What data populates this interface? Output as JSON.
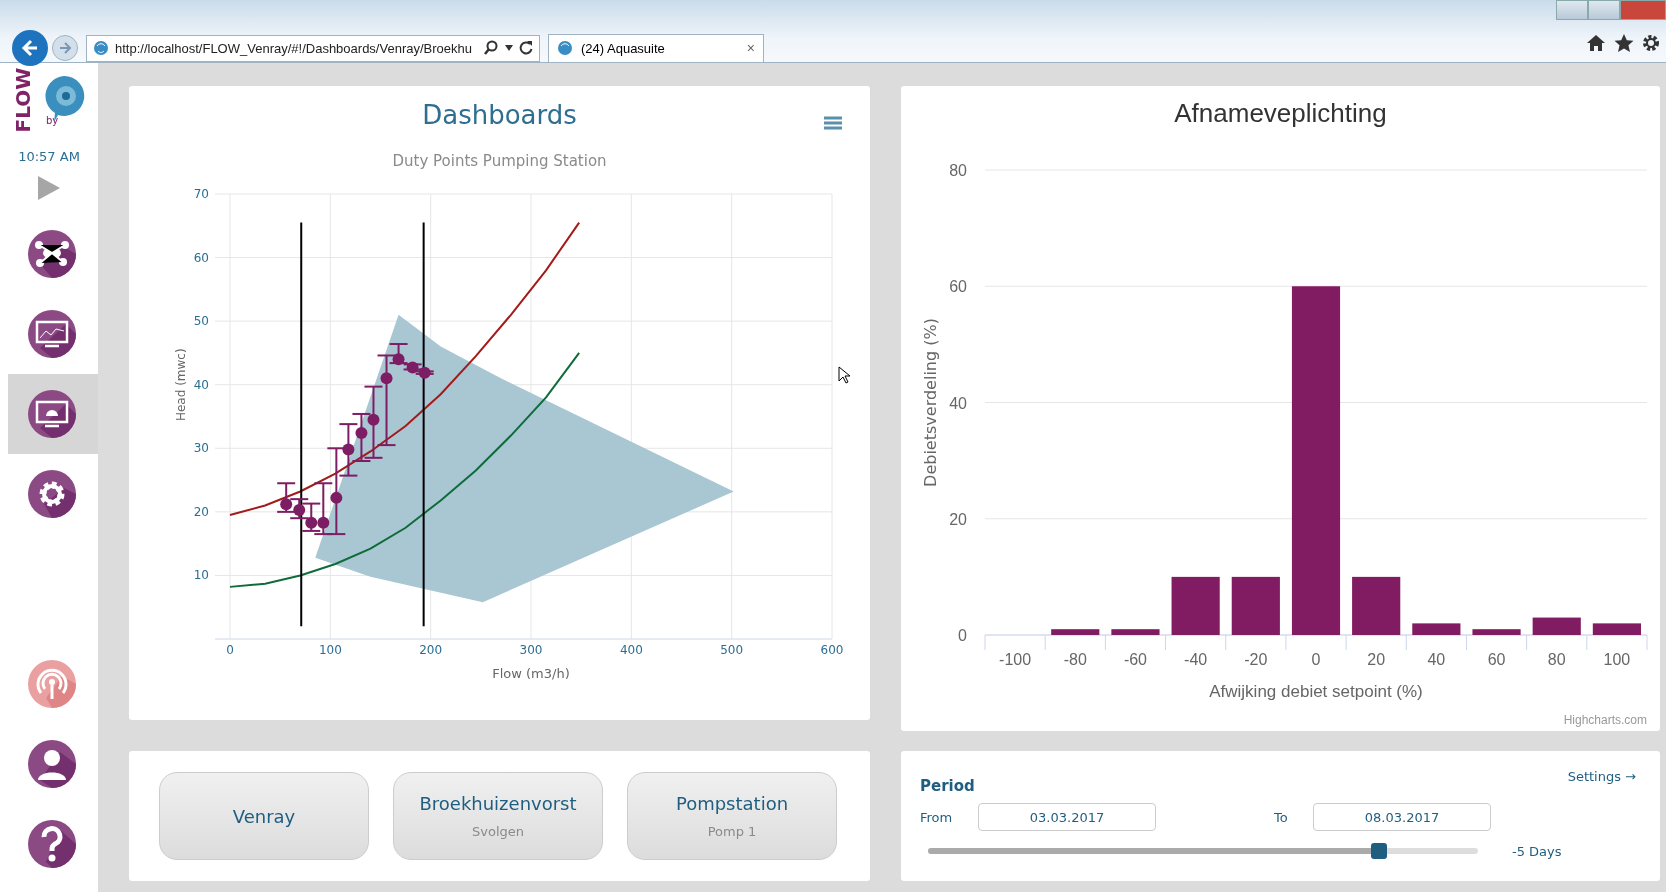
{
  "browser": {
    "url": "http://localhost/FLOW_Venray/#!/Dashboards/Venray/Broekhu",
    "tab": {
      "label": "(24) Aquasuite",
      "close": "×"
    }
  },
  "sidebar": {
    "logo": {
      "wordmark": "FLOW",
      "by": "by"
    },
    "time": "10:57 AM",
    "items": [
      {
        "selected": false
      },
      {
        "selected": false
      },
      {
        "selected": true
      },
      {
        "selected": false
      },
      {
        "selected": false
      },
      {
        "selected": false
      },
      {
        "selected": false
      }
    ]
  },
  "duty_panel": {
    "title": "Dashboards",
    "subtitle": "Duty Points Pumping Station",
    "chart_data": {
      "type": "line",
      "grid": true,
      "xlabel": "Flow (m3/h)",
      "ylabel": "Head (mwc)",
      "xlim": [
        0,
        600
      ],
      "ylim": [
        0,
        70
      ],
      "xticks": [
        0,
        100,
        200,
        300,
        400,
        500,
        600
      ],
      "yticks": [
        10,
        20,
        30,
        40,
        50,
        60,
        70
      ],
      "series": [
        {
          "type": "area",
          "color": "#a9c6d3",
          "x": [
            85,
            168,
            210,
            270,
            502,
            252,
            140
          ],
          "values": [
            12.8,
            51,
            46,
            41,
            23.2,
            5.8,
            9.8
          ]
        },
        {
          "type": "line",
          "color": "#a31a1a",
          "x": [
            0,
            35,
            70,
            105,
            140,
            175,
            210,
            245,
            280,
            315,
            348
          ],
          "values": [
            19.5,
            21,
            23.2,
            26,
            29.5,
            33.5,
            38.5,
            44.5,
            51,
            58,
            65.5
          ]
        },
        {
          "type": "line",
          "color": "#0f6b3a",
          "x": [
            0,
            35,
            70,
            105,
            140,
            175,
            210,
            245,
            280,
            315,
            348
          ],
          "values": [
            8.2,
            8.7,
            10,
            11.8,
            14.2,
            17.5,
            21.8,
            26.5,
            32,
            38,
            45
          ]
        },
        {
          "type": "line",
          "color": "#000000",
          "x": [
            71,
            71
          ],
          "values": [
            2,
            65.5
          ]
        },
        {
          "type": "line",
          "color": "#000000",
          "x": [
            193,
            193
          ],
          "values": [
            2,
            65.5
          ]
        },
        {
          "type": "scatter",
          "color": "#7d1d63",
          "x": [
            56,
            69,
            81,
            93,
            106,
            118,
            131,
            143,
            156,
            168,
            182,
            194
          ],
          "values": [
            21.2,
            20.3,
            18.3,
            18.3,
            22.2,
            29.8,
            32.4,
            34.5,
            41,
            44,
            42.7,
            41.9
          ],
          "errors": [
            [
              20,
              24.5
            ],
            [
              19,
              22
            ],
            [
              17,
              21.3
            ],
            [
              16.5,
              24.5
            ],
            [
              16.5,
              30
            ],
            [
              25.7,
              33.8
            ],
            [
              28,
              35.4
            ],
            [
              28.5,
              39.7
            ],
            [
              30.5,
              44.6
            ],
            [
              43.4,
              46.4
            ],
            [
              42.4,
              43.2
            ],
            [
              41.7,
              42.1
            ]
          ]
        }
      ]
    }
  },
  "distribution_panel": {
    "title": "Afnameveplichting",
    "credit": "Highcharts.com",
    "chart_data": {
      "type": "bar",
      "grid": true,
      "xlabel": "Afwijking debiet setpoint (%)",
      "ylabel": "Debietsverdeling (%)",
      "categories": [
        "-100",
        "-80",
        "-60",
        "-40",
        "-20",
        "0",
        "20",
        "40",
        "60",
        "80",
        "100"
      ],
      "ylim": [
        0,
        80
      ],
      "yticks": [
        0,
        20,
        40,
        60,
        80
      ],
      "series": [
        {
          "color": "#821c62",
          "values": [
            0,
            1,
            1,
            10,
            10,
            60,
            10,
            2,
            1,
            3,
            2
          ]
        }
      ]
    }
  },
  "navigation": [
    {
      "title": "Venray"
    },
    {
      "title": "Broekhuizenvorst",
      "subtitle": "Svolgen"
    },
    {
      "title": "Pompstation",
      "subtitle": "Pomp 1"
    }
  ],
  "period": {
    "title": "Period",
    "settings_link": "Settings →",
    "from_label": "From",
    "from_value": "03.03.2017",
    "to_label": "To",
    "to_value": "08.03.2017",
    "slider": {
      "level": 0.82
    },
    "range_label": "-5 Days"
  }
}
